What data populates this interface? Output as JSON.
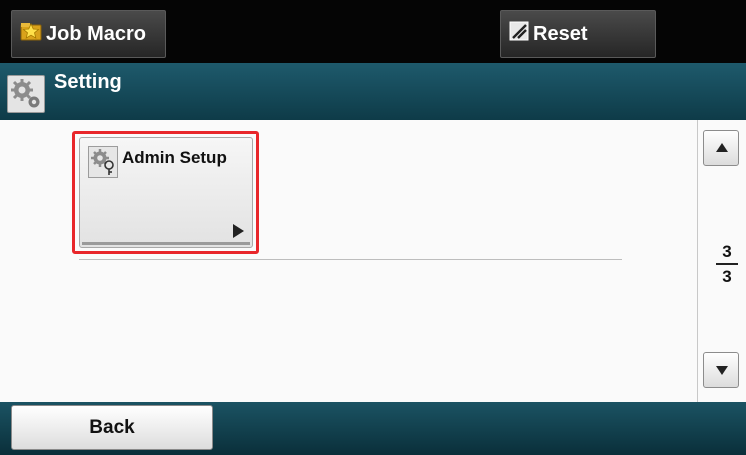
{
  "topbar": {
    "job_macro_label": "Job Macro",
    "job_macro_icon": "star-folder-icon",
    "reset_label": "Reset",
    "reset_icon": "reset-icon"
  },
  "header": {
    "title": "Setting",
    "icon": "gears-icon"
  },
  "menu": {
    "items": [
      {
        "label": "Admin Setup",
        "icon": "admin-gear-key-icon"
      }
    ]
  },
  "pager": {
    "current": "3",
    "total": "3"
  },
  "footer": {
    "back_label": "Back"
  },
  "colors": {
    "selection_outline": "#e8262a",
    "header_teal": "#1e5a6c",
    "footer_teal": "#0e3b48"
  }
}
